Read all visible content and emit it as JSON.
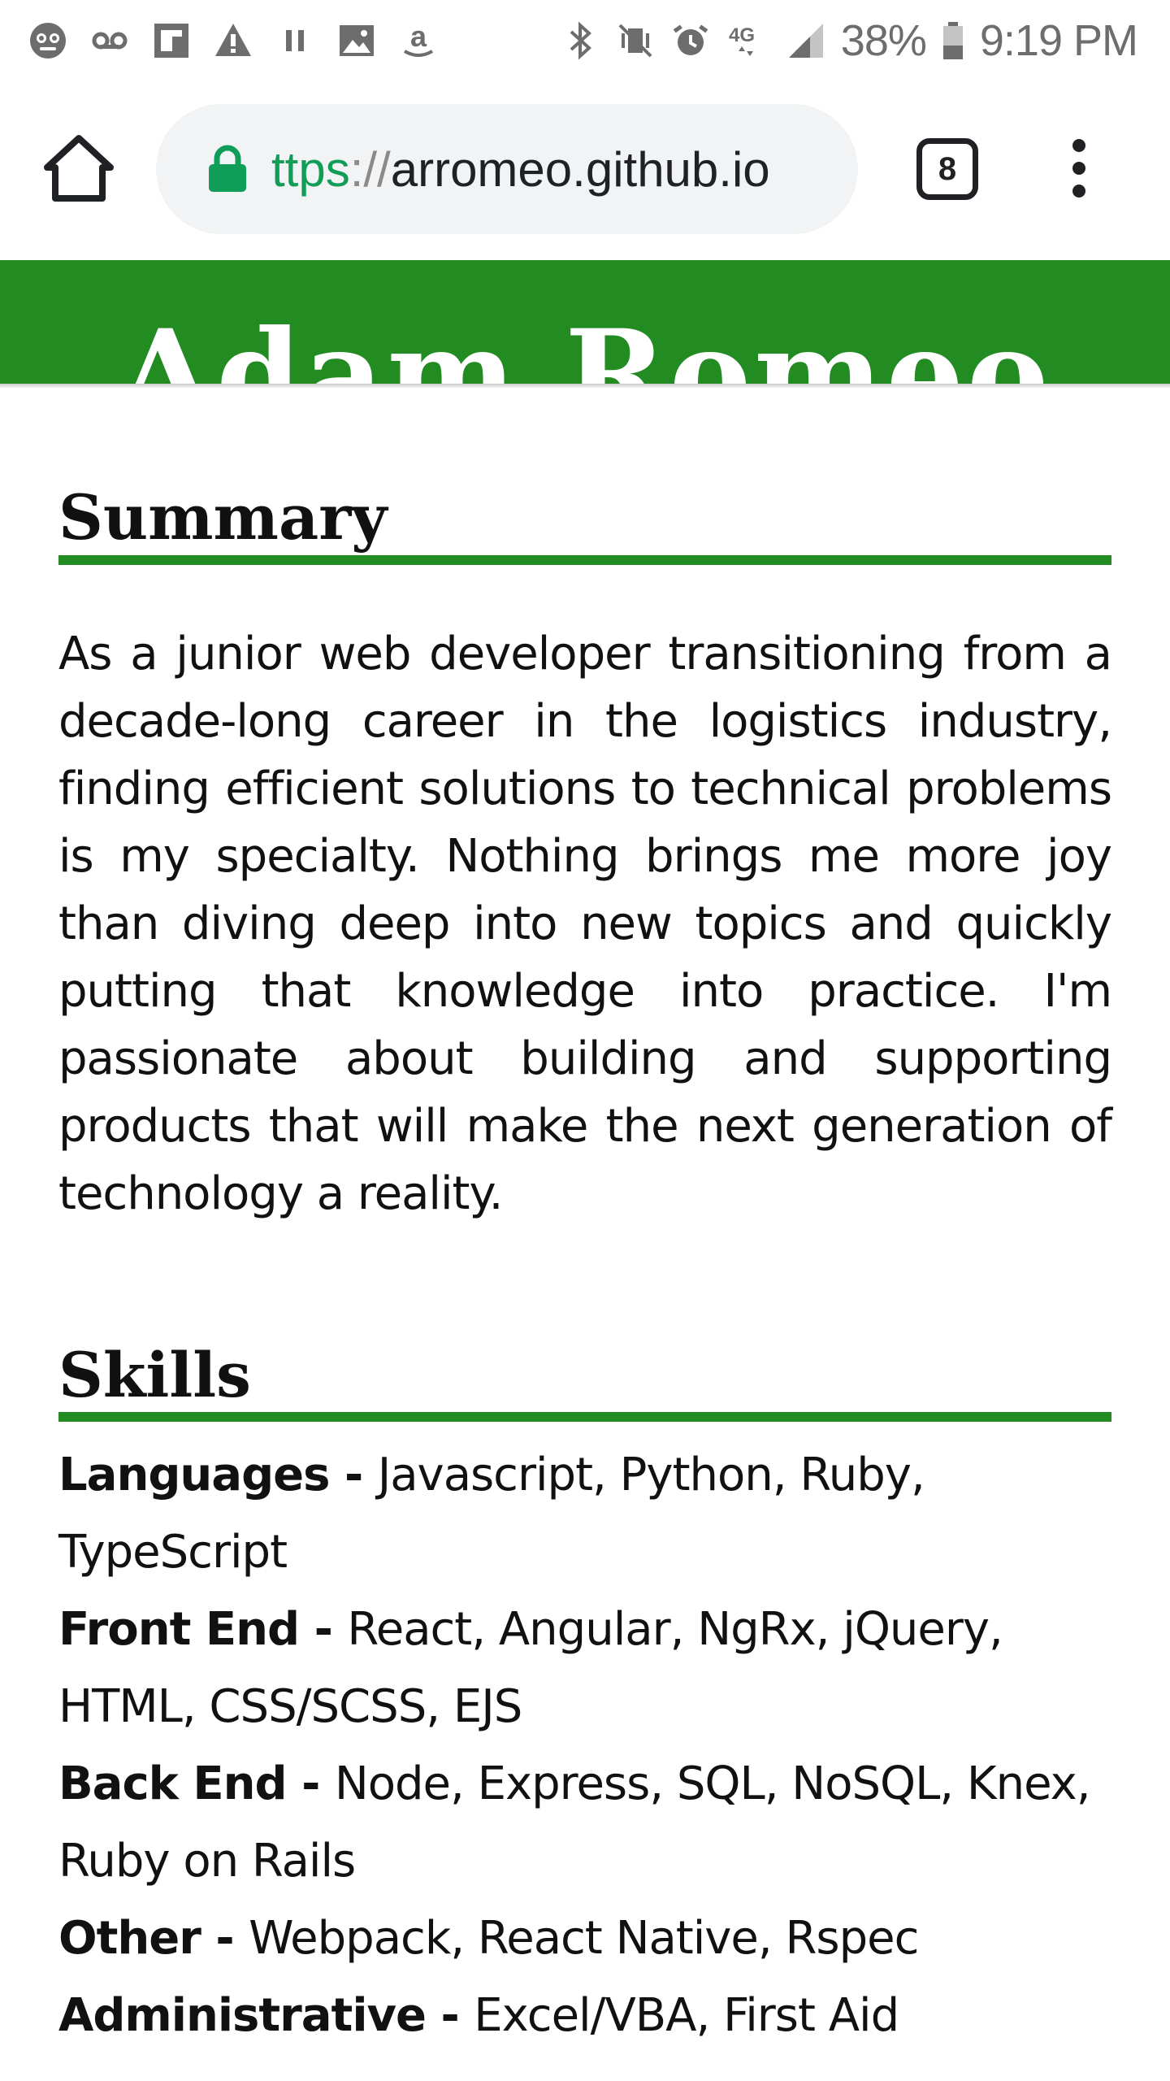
{
  "status_bar": {
    "left_icons": [
      "app-icon",
      "voicemail-icon",
      "flipboard-icon",
      "warning-icon",
      "pause-icon",
      "image-icon",
      "amazon-icon"
    ],
    "right_icons": [
      "bluetooth-icon",
      "vibrate-icon",
      "alarm-icon",
      "4g-icon",
      "signal-icon",
      "battery-icon"
    ],
    "network": "4G",
    "battery": "38%",
    "time": "9:19 PM"
  },
  "browser": {
    "url_scheme": "ttps",
    "url_sep": "://",
    "url_host": "arromeo.github.io",
    "tab_count": "8"
  },
  "header": {
    "name": "Adam Romeo",
    "color": "#228b22"
  },
  "summary": {
    "title": "Summary",
    "text": "As a junior web developer transitioning from a decade-long career in the logistics industry, finding efficient solutions to technical problems is my specialty. Nothing brings me more joy than diving deep into new topics and quickly putting that knowledge into practice. I'm passionate about building and supporting products that will make the next generation of technology a reality."
  },
  "skills": {
    "title": "Skills",
    "items": [
      {
        "label": "Languages - ",
        "value": "Javascript, Python, Ruby, TypeScript"
      },
      {
        "label": "Front End - ",
        "value": "React, Angular, NgRx, jQuery, HTML, CSS/SCSS, EJS"
      },
      {
        "label": "Back End - ",
        "value": "Node, Express, SQL, NoSQL, Knex, Ruby on Rails"
      },
      {
        "label": "Other - ",
        "value": "Webpack, React Native, Rspec"
      },
      {
        "label": "Administrative - ",
        "value": "Excel/VBA, First Aid"
      }
    ]
  }
}
